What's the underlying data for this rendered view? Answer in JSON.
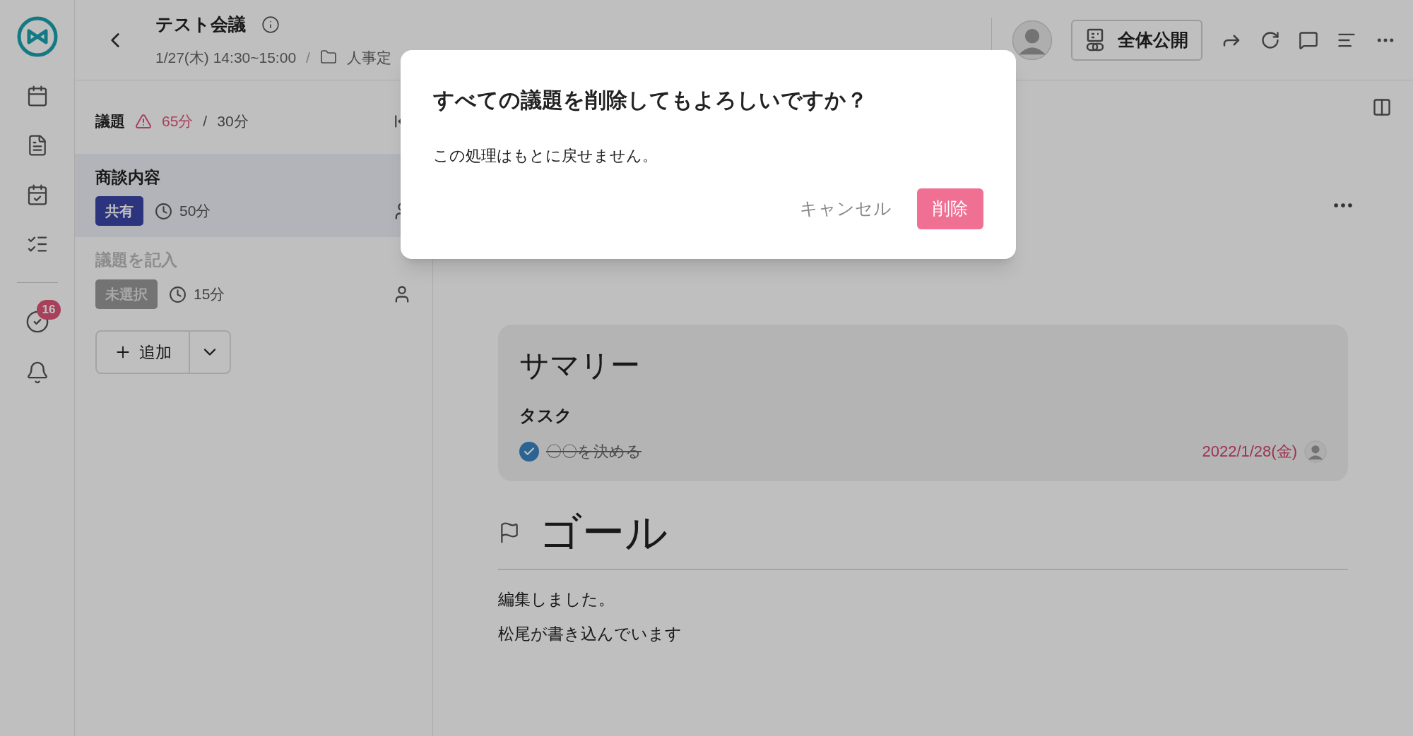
{
  "sidebar": {
    "badge": "16"
  },
  "header": {
    "title": "テスト会議",
    "datetime": "1/27(木) 14:30~15:00",
    "separator": "/",
    "folder": "人事定",
    "visibility": "全体公開"
  },
  "agenda": {
    "label": "議題",
    "total": "65分",
    "separator": "/",
    "limit": "30分",
    "over": true,
    "items": [
      {
        "title": "商談内容",
        "status": "共有",
        "kind": "shared",
        "duration": "50分",
        "selected": true
      },
      {
        "placeholder": "議題を記入",
        "status": "未選択",
        "kind": "unselected",
        "duration": "15分",
        "selected": false
      }
    ],
    "add_button": "追加"
  },
  "content": {
    "summary": {
      "heading": "サマリー",
      "task_label": "タスク",
      "tasks": [
        {
          "text": "〇〇を決める",
          "checked": true,
          "due": "2022/1/28(金)"
        }
      ]
    },
    "goal": {
      "heading": "ゴール",
      "lines": [
        "編集しました。",
        "松尾が書き込んでいます"
      ]
    }
  },
  "dialog": {
    "title": "すべての議題を削除してもよろしいですか？",
    "message": "この処理はもとに戻せません。",
    "cancel": "キャンセル",
    "confirm": "削除"
  }
}
